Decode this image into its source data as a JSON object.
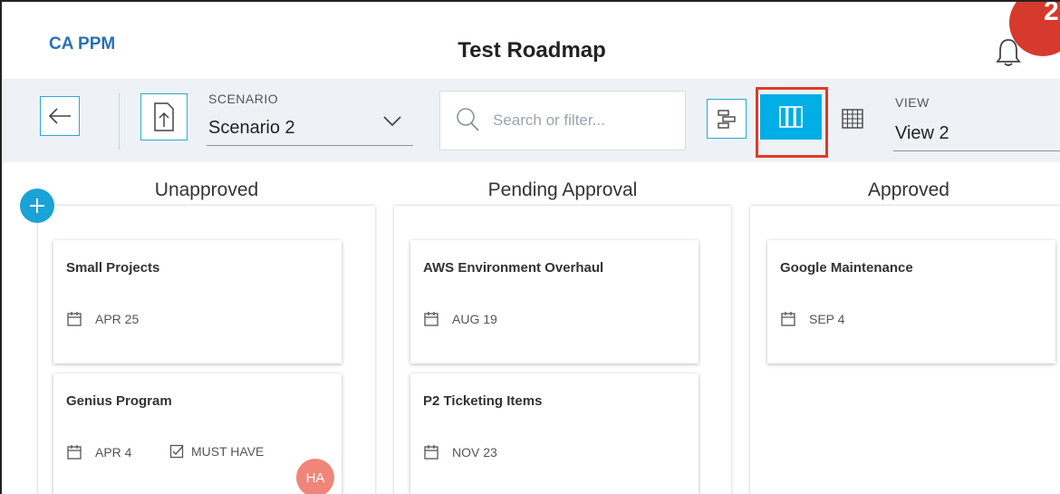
{
  "header": {
    "brand": "CA PPM",
    "title": "Test Roadmap",
    "badge_count": "2"
  },
  "toolbar": {
    "scenario_label": "SCENARIO",
    "scenario_value": "Scenario 2",
    "search_placeholder": "Search or filter...",
    "view_label": "VIEW",
    "view_value": "View 2",
    "active_view": "board"
  },
  "columns": [
    {
      "title": "Unapproved",
      "cards": [
        {
          "name": "Small Projects",
          "date": "APR 25"
        },
        {
          "name": "Genius Program",
          "date": "APR 4",
          "tag": "MUST HAVE",
          "avatar": "HA"
        }
      ]
    },
    {
      "title": "Pending Approval",
      "cards": [
        {
          "name": "AWS Environment Overhaul",
          "date": "AUG 19"
        },
        {
          "name": "P2 Ticketing Items",
          "date": "NOV 23"
        }
      ]
    },
    {
      "title": "Approved",
      "cards": [
        {
          "name": "Google Maintenance",
          "date": "SEP 4"
        }
      ]
    }
  ],
  "colors": {
    "accent": "#00aee6",
    "brand": "#2b6fb6",
    "highlight": "#e03a26",
    "avatar": "#f0857a",
    "badge": "#d63a2c"
  },
  "icons": [
    "back-arrow-icon",
    "export-icon",
    "chevron-down-icon",
    "search-icon",
    "timeline-icon",
    "board-icon",
    "grid-icon",
    "bell-icon",
    "plus-icon",
    "calendar-icon",
    "checkbox-icon"
  ]
}
